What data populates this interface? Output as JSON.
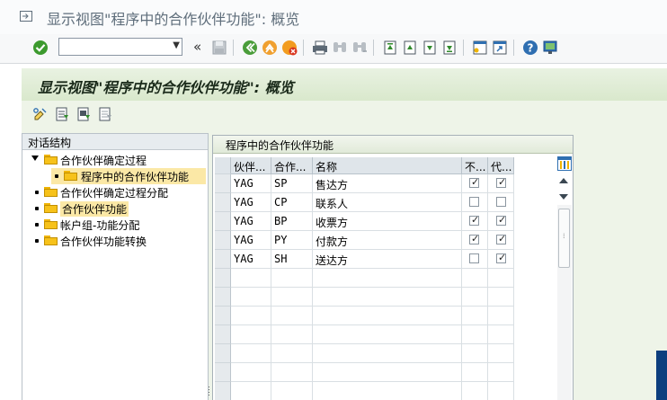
{
  "window": {
    "title": "显示视图\"程序中的合作伙伴功能\": 概览"
  },
  "toolbar": {
    "command_field": {
      "value": "",
      "placeholder": ""
    },
    "collapse_label": "«",
    "icons": [
      "enter-check-icon",
      "save-icon",
      "back-icon",
      "exit-icon",
      "cancel-icon",
      "print-icon",
      "find-icon",
      "find-next-icon",
      "first-page-icon",
      "prev-page-icon",
      "next-page-icon",
      "last-page-icon",
      "new-session-icon",
      "shortcut-icon",
      "help-icon",
      "customize-layout-icon"
    ]
  },
  "header": {
    "title": "显示视图\"程序中的合作伙伴功能\": 概览"
  },
  "app_toolbar": {
    "icons": [
      "display-change-icon",
      "select-all-icon",
      "select-block-icon",
      "deselect-all-icon"
    ]
  },
  "tree": {
    "header": "对话结构",
    "items": [
      {
        "label": "合作伙伴确定过程",
        "expanded": true,
        "level": 0
      },
      {
        "label": "程序中的合作伙伴功能",
        "selected": true,
        "level": 1
      },
      {
        "label": "合作伙伴确定过程分配",
        "level": 0
      },
      {
        "label": "合作伙伴功能",
        "highlighted": true,
        "level": 0
      },
      {
        "label": "帐户组-功能分配",
        "level": 0
      },
      {
        "label": "合作伙伴功能转换",
        "level": 0
      }
    ]
  },
  "grid": {
    "title": "程序中的合作伙伴功能",
    "columns": [
      "伙伴...",
      "合作...",
      "名称",
      "不...",
      "代..."
    ],
    "rows": [
      {
        "proc": "YAG",
        "func": "SP",
        "name": "售达方",
        "not_changeable": true,
        "mandatory": true
      },
      {
        "proc": "YAG",
        "func": "CP",
        "name": "联系人",
        "not_changeable": false,
        "mandatory": false
      },
      {
        "proc": "YAG",
        "func": "BP",
        "name": "收票方",
        "not_changeable": true,
        "mandatory": true
      },
      {
        "proc": "YAG",
        "func": "PY",
        "name": "付款方",
        "not_changeable": true,
        "mandatory": true
      },
      {
        "proc": "YAG",
        "func": "SH",
        "name": "送达方",
        "not_changeable": false,
        "mandatory": true
      }
    ],
    "empty_rows": 7
  },
  "colors": {
    "header_band": "#d9e8cc",
    "selected_tree_item": "#fbe8a6",
    "folder": "#f7c21a"
  }
}
